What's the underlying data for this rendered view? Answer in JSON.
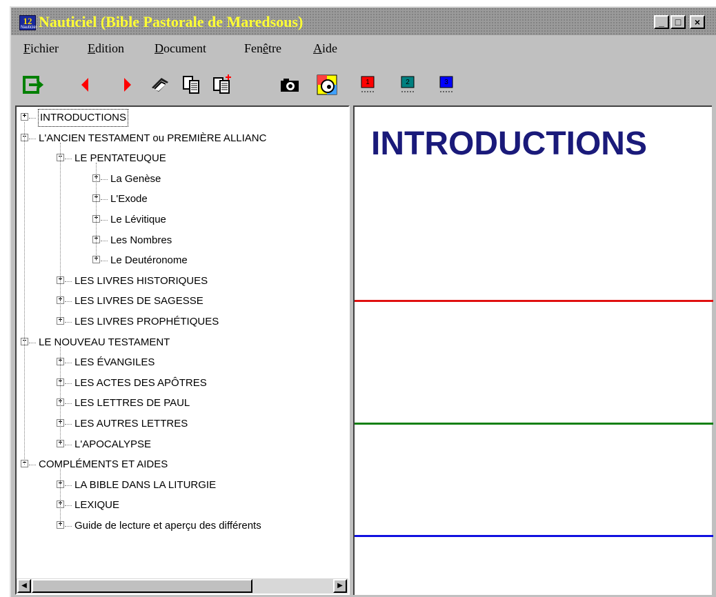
{
  "window": {
    "title": "Nauticiel (Bible Pastorale de Maredsous)",
    "app_icon_letters": "12",
    "app_icon_caption": "Nauticiel",
    "controls": {
      "minimize": "_",
      "maximize": "□",
      "close": "×"
    }
  },
  "menu": [
    {
      "label_prefix": "",
      "accel": "F",
      "label_suffix": "ichier"
    },
    {
      "label_prefix": "",
      "accel": "E",
      "label_suffix": "dition"
    },
    {
      "label_prefix": "",
      "accel": "D",
      "label_suffix": "ocument"
    },
    {
      "label_prefix": "Fen",
      "accel": "ê",
      "label_suffix": "tre"
    },
    {
      "label_prefix": "",
      "accel": "A",
      "label_suffix": "ide"
    }
  ],
  "toolbar": [
    {
      "icon": "exit-icon"
    },
    {
      "icon": "back-icon"
    },
    {
      "icon": "forward-icon"
    },
    {
      "icon": "print-icon"
    },
    {
      "icon": "copy-icon"
    },
    {
      "icon": "copy-add-icon"
    },
    {
      "icon": "camera-icon"
    },
    {
      "icon": "palette-icon"
    },
    {
      "icon": "bookmark-1-icon",
      "label": "1"
    },
    {
      "icon": "bookmark-2-icon",
      "label": "2"
    },
    {
      "icon": "bookmark-3-icon",
      "label": "3"
    }
  ],
  "tree": [
    {
      "label": "INTRODUCTIONS",
      "level": 0,
      "expander": "+",
      "selected": true
    },
    {
      "label": "L'ANCIEN TESTAMENT  ou  PREMIÈRE ALLIANC",
      "level": 0,
      "expander": "−"
    },
    {
      "label": "LE PENTATEUQUE",
      "level": 1,
      "expander": "−"
    },
    {
      "label": "La Genèse",
      "level": 2,
      "expander": "+"
    },
    {
      "label": "L'Exode",
      "level": 2,
      "expander": "+"
    },
    {
      "label": "Le Lévitique",
      "level": 2,
      "expander": "+"
    },
    {
      "label": "Les Nombres",
      "level": 2,
      "expander": "+"
    },
    {
      "label": "Le Deutéronome",
      "level": 2,
      "expander": "+"
    },
    {
      "label": "LES LIVRES HISTORIQUES",
      "level": 1,
      "expander": "+"
    },
    {
      "label": "LES LIVRES DE SAGESSE",
      "level": 1,
      "expander": "+"
    },
    {
      "label": "LES LIVRES PROPHÉTIQUES",
      "level": 1,
      "expander": "+"
    },
    {
      "label": "LE NOUVEAU TESTAMENT",
      "level": 0,
      "expander": "−"
    },
    {
      "label": "LES ÉVANGILES",
      "level": 1,
      "expander": "+"
    },
    {
      "label": "LES ACTES DES APÔTRES",
      "level": 1,
      "expander": "+"
    },
    {
      "label": "LES LETTRES DE PAUL",
      "level": 1,
      "expander": "+"
    },
    {
      "label": "LES AUTRES LETTRES",
      "level": 1,
      "expander": "+"
    },
    {
      "label": "L'APOCALYPSE",
      "level": 1,
      "expander": "+"
    },
    {
      "label": "COMPLÉMENTS ET AIDES",
      "level": 0,
      "expander": "−"
    },
    {
      "label": "LA BIBLE DANS LA LITURGIE",
      "level": 1,
      "expander": "+"
    },
    {
      "label": "LEXIQUE",
      "level": 1,
      "expander": "+"
    },
    {
      "label": "Guide de lecture et aperçu des différents",
      "level": 1,
      "expander": "+"
    }
  ],
  "scrollbar": {
    "left_arrow": "◀",
    "right_arrow": "▶"
  },
  "content": {
    "heading": "INTRODUCTIONS",
    "heading_color": "#1a1a7a",
    "rule_colors": [
      "#e01010",
      "#108010",
      "#1010e0"
    ]
  }
}
